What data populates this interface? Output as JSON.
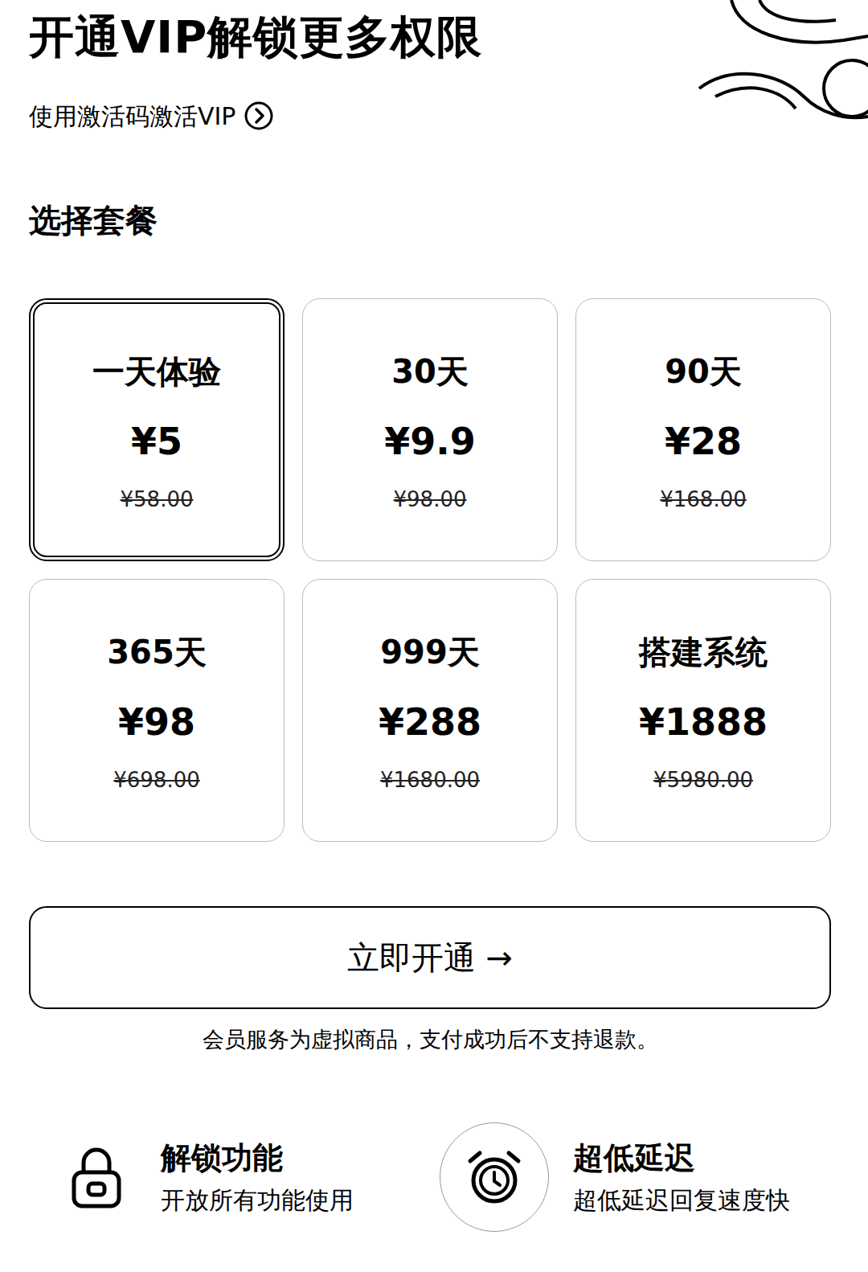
{
  "header": {
    "title": "开通VIP解锁更多权限",
    "activation_link": "使用激活码激活VIP"
  },
  "section_title": "选择套餐",
  "plans": [
    {
      "label": "一天体验",
      "price": "¥5",
      "original_price": "¥58.00",
      "selected": true
    },
    {
      "label": "30天",
      "price": "¥9.9",
      "original_price": "¥98.00",
      "selected": false
    },
    {
      "label": "90天",
      "price": "¥28",
      "original_price": "¥168.00",
      "selected": false
    },
    {
      "label": "365天",
      "price": "¥98",
      "original_price": "¥698.00",
      "selected": false
    },
    {
      "label": "999天",
      "price": "¥288",
      "original_price": "¥1680.00",
      "selected": false
    },
    {
      "label": "搭建系统",
      "price": "¥1888",
      "original_price": "¥5980.00",
      "selected": false
    }
  ],
  "submit_button": "立即开通 →",
  "notice": "会员服务为虚拟商品，支付成功后不支持退款。",
  "features": [
    {
      "title": "解锁功能",
      "description": "开放所有功能使用"
    },
    {
      "title": "超低延迟",
      "description": "超低延迟回复速度快"
    }
  ]
}
